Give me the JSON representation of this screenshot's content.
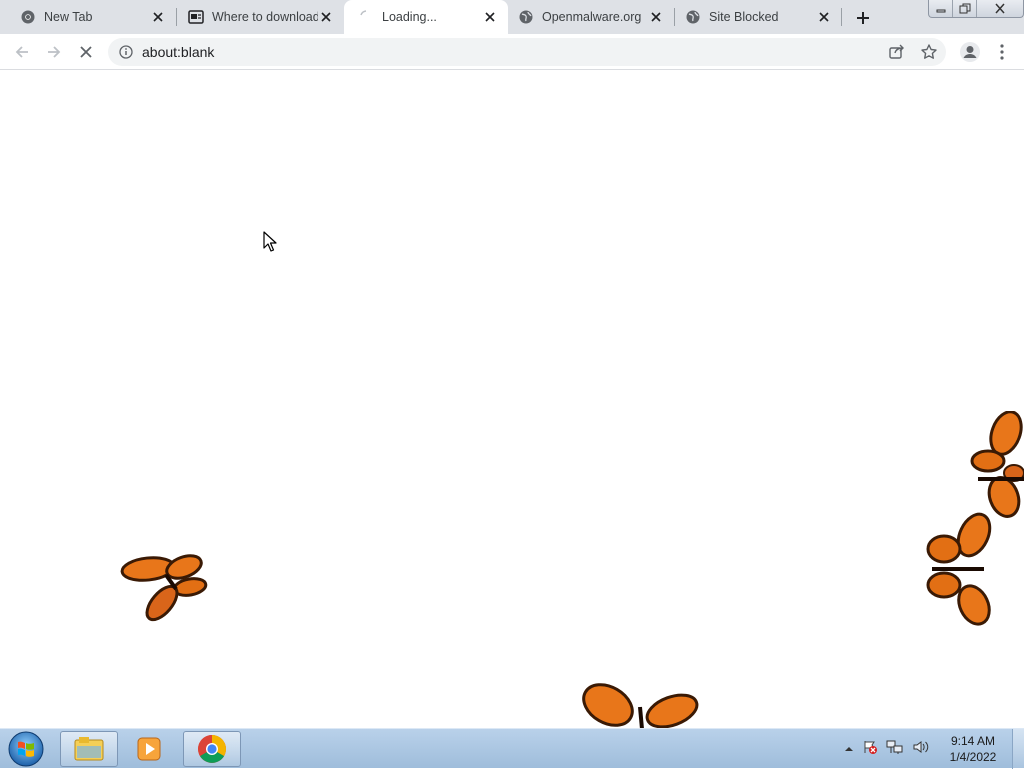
{
  "browser": {
    "tabs": [
      {
        "title": "New Tab",
        "icon": "chrome-icon"
      },
      {
        "title": "Where to download",
        "icon": "site-icon"
      },
      {
        "title": "Loading...",
        "icon": "loading-spinner-icon",
        "active": true
      },
      {
        "title": "Openmalware.org",
        "icon": "globe-icon"
      },
      {
        "title": "Site Blocked",
        "icon": "globe-icon"
      }
    ],
    "url": "about:blank"
  },
  "taskbar": {
    "apps": [
      "file-explorer-icon",
      "media-player-icon",
      "chrome-icon"
    ],
    "time": "9:14 AM",
    "date": "1/4/2022"
  },
  "colors": {
    "tabstrip": "#dee1e6",
    "taskbar": "#b9d1ea",
    "butterfly_orange": "#e8761a"
  }
}
